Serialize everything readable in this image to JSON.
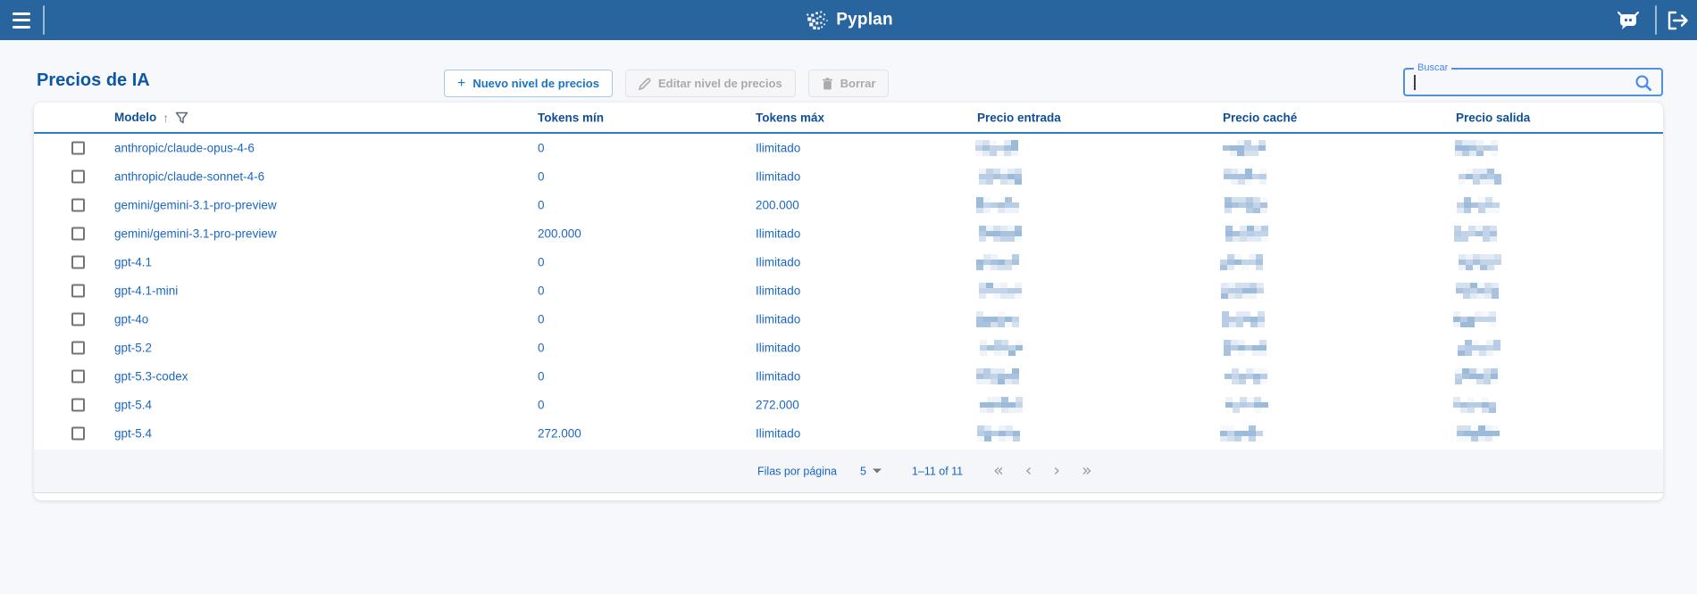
{
  "topbar": {
    "app_name": "Pyplan"
  },
  "page": {
    "title": "Precios de IA"
  },
  "actions": {
    "new_label": "Nuevo nivel de precios",
    "edit_label": "Editar nivel de precios",
    "delete_label": "Borrar"
  },
  "search": {
    "label": "Buscar",
    "value": "",
    "placeholder": ""
  },
  "table": {
    "columns": {
      "modelo": "Modelo",
      "tokens_min": "Tokens mín",
      "tokens_max": "Tokens máx",
      "precio_entrada": "Precio entrada",
      "precio_cache": "Precio caché",
      "precio_salida": "Precio salida"
    },
    "rows": [
      {
        "modelo": "anthropic/claude-opus-4-6",
        "tokens_min": "0",
        "tokens_max": "Ilimitado",
        "precio_entrada_redacted": true,
        "precio_cache_redacted": true,
        "precio_salida_redacted": true
      },
      {
        "modelo": "anthropic/claude-sonnet-4-6",
        "tokens_min": "0",
        "tokens_max": "Ilimitado",
        "precio_entrada_redacted": true,
        "precio_cache_redacted": true,
        "precio_salida_redacted": true
      },
      {
        "modelo": "gemini/gemini-3.1-pro-preview",
        "tokens_min": "0",
        "tokens_max": "200.000",
        "precio_entrada_redacted": true,
        "precio_cache_redacted": true,
        "precio_salida_redacted": true
      },
      {
        "modelo": "gemini/gemini-3.1-pro-preview",
        "tokens_min": "200.000",
        "tokens_max": "Ilimitado",
        "precio_entrada_redacted": true,
        "precio_cache_redacted": true,
        "precio_salida_redacted": true
      },
      {
        "modelo": "gpt-4.1",
        "tokens_min": "0",
        "tokens_max": "Ilimitado",
        "precio_entrada_redacted": true,
        "precio_cache_redacted": true,
        "precio_salida_redacted": true
      },
      {
        "modelo": "gpt-4.1-mini",
        "tokens_min": "0",
        "tokens_max": "Ilimitado",
        "precio_entrada_redacted": true,
        "precio_cache_redacted": true,
        "precio_salida_redacted": true
      },
      {
        "modelo": "gpt-4o",
        "tokens_min": "0",
        "tokens_max": "Ilimitado",
        "precio_entrada_redacted": true,
        "precio_cache_redacted": true,
        "precio_salida_redacted": true
      },
      {
        "modelo": "gpt-5.2",
        "tokens_min": "0",
        "tokens_max": "Ilimitado",
        "precio_entrada_redacted": true,
        "precio_cache_redacted": true,
        "precio_salida_redacted": true
      },
      {
        "modelo": "gpt-5.3-codex",
        "tokens_min": "0",
        "tokens_max": "Ilimitado",
        "precio_entrada_redacted": true,
        "precio_cache_redacted": true,
        "precio_salida_redacted": true
      },
      {
        "modelo": "gpt-5.4",
        "tokens_min": "0",
        "tokens_max": "272.000",
        "precio_entrada_redacted": true,
        "precio_cache_redacted": true,
        "precio_salida_redacted": true
      },
      {
        "modelo": "gpt-5.4",
        "tokens_min": "272.000",
        "tokens_max": "Ilimitado",
        "precio_entrada_redacted": true,
        "precio_cache_redacted": true,
        "precio_salida_redacted": true
      }
    ]
  },
  "pagination": {
    "rows_per_page_label": "Filas por página",
    "rows_per_page_value": "5",
    "range": "1–11 of 11",
    "nav": {
      "first": "«",
      "prev": "‹",
      "next": "›",
      "last": "»"
    }
  },
  "colors": {
    "topbar": "#28659e",
    "accent": "#1a67c5",
    "header_text": "#0d4f9b",
    "redacted_dark": [
      "#9cbad9",
      "#a9c3df",
      "#b7cde5",
      "#c3d4e9"
    ],
    "redacted_light": [
      "#d5e0ef",
      "#e2eaf5",
      "#eef3f9",
      "#f5f8fc"
    ]
  }
}
